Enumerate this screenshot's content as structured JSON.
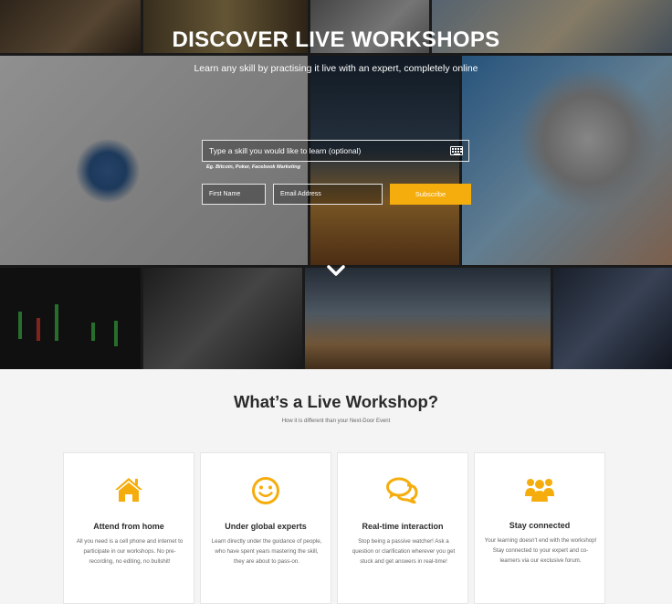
{
  "hero": {
    "title": "DISCOVER LIVE WORKSHOPS",
    "subtitle": "Learn any skill by practising it live with an expert, completely online",
    "skill_input_placeholder": "Type a skill you would like to learn (optional)",
    "skill_hint": "Eg. Bitcoin, Poker, Facebook Marketing",
    "first_name_placeholder": "First Name",
    "email_placeholder": "Email Address",
    "subscribe_label": "Subscribe",
    "keyboard_icon": "keyboard-icon",
    "scroll_icon": "chevron-down-icon"
  },
  "section": {
    "title": "What’s a Live Workshop?",
    "subtitle": "How it is different than your Next-Door Event"
  },
  "cards": [
    {
      "icon": "home-icon",
      "title": "Attend from home",
      "text": "All you need is a cell phone and internet to participate in our workshops. No pre-recording, no editing, no bullshit!"
    },
    {
      "icon": "smile-icon",
      "title": "Under global experts",
      "text": "Learn directly under the guidance of people, who have spent years mastering the skill, they are about to pass-on."
    },
    {
      "icon": "chat-icon",
      "title": "Real-time interaction",
      "text": "Stop being a passive watcher! Ask a question or clarification wherever you get stuck and get answers in real-time!"
    },
    {
      "icon": "users-icon",
      "title": "Stay connected",
      "text": "Your learning doesn't end with the workshop! Stay connected to your expert and co-learners via our exclusive forum."
    }
  ],
  "colors": {
    "accent": "#f5ad0e",
    "heading": "#2b2b2b",
    "background": "#f4f4f4"
  }
}
